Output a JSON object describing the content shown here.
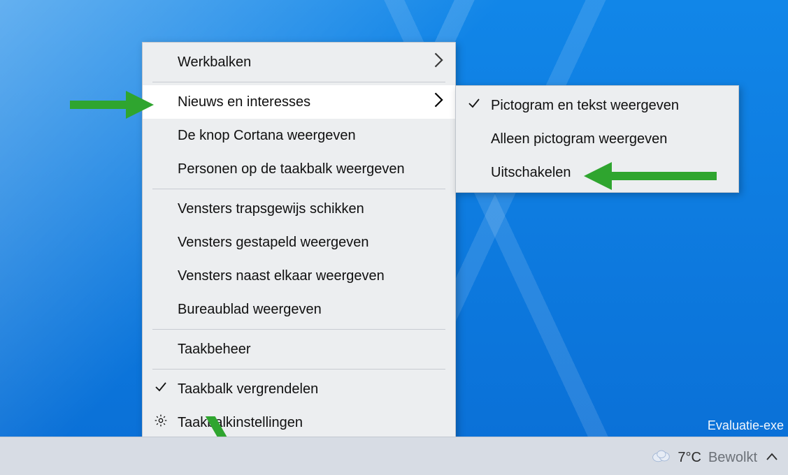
{
  "main_menu": {
    "items": [
      {
        "label": "Werkbalken",
        "chevron": true
      },
      {
        "label": "Nieuws en interesses",
        "chevron": true,
        "hover": true
      },
      {
        "label": "De knop Cortana weergeven"
      },
      {
        "label": "Personen op de taakbalk weergeven"
      },
      {
        "label": "Vensters trapsgewijs schikken"
      },
      {
        "label": "Vensters gestapeld weergeven"
      },
      {
        "label": "Vensters naast elkaar weergeven"
      },
      {
        "label": "Bureaublad weergeven"
      },
      {
        "label": "Taakbeheer"
      },
      {
        "label": "Taakbalk vergrendelen",
        "check": true
      },
      {
        "label": "Taakbalkinstellingen",
        "gear": true
      }
    ]
  },
  "sub_menu": {
    "items": [
      {
        "label": "Pictogram en tekst weergeven",
        "check": true
      },
      {
        "label": "Alleen pictogram weergeven"
      },
      {
        "label": "Uitschakelen"
      }
    ]
  },
  "taskbar": {
    "weather_temp": "7°C",
    "weather_condition": "Bewolkt"
  },
  "watermark": "Evaluatie-exe"
}
